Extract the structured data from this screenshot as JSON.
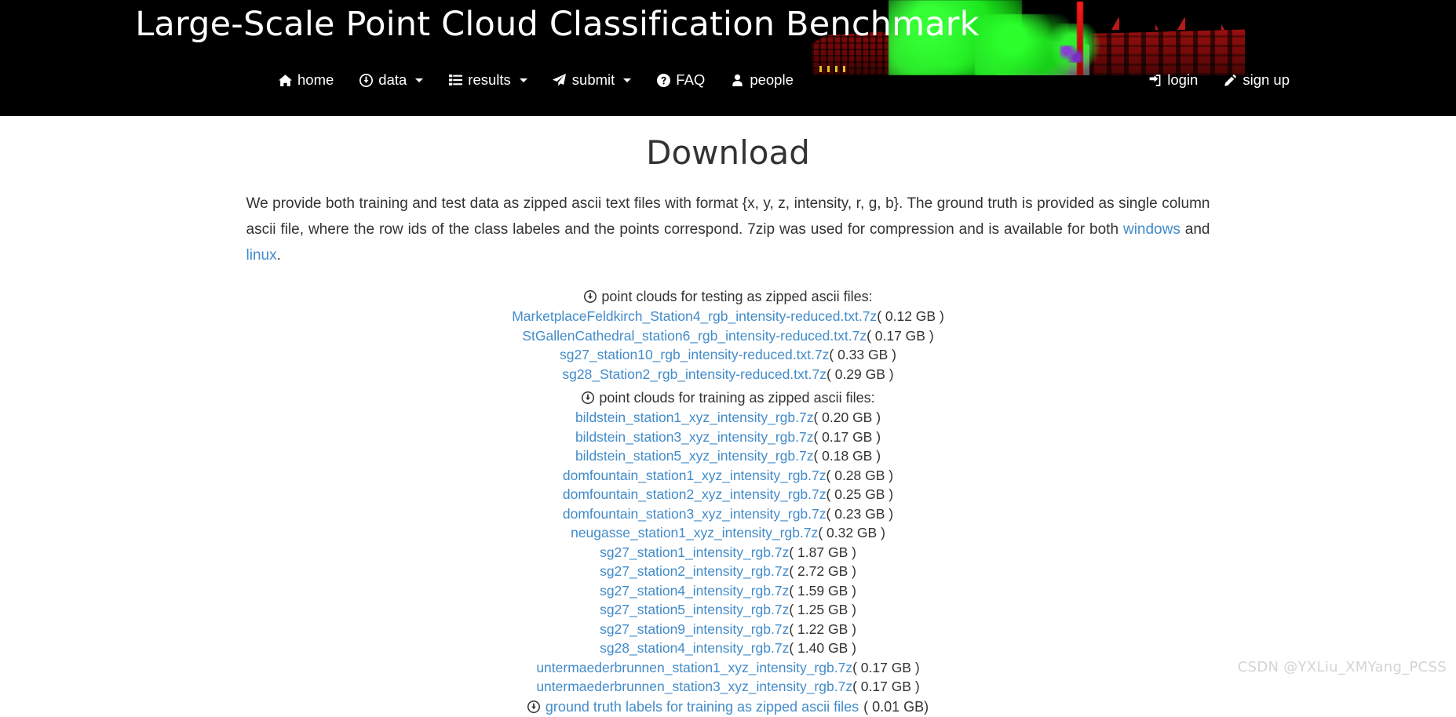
{
  "banner": {
    "title": "Large-Scale Point Cloud Classification Benchmark",
    "artwork_alt": "semantic point cloud of buildings and vegetation",
    "colors": {
      "background": "#000000",
      "buildings": "#8d0c0c",
      "vegetation": "#22f022",
      "ground": "#9a9a9a"
    }
  },
  "nav": {
    "left_items": [
      {
        "label": "home",
        "icon": "home-icon",
        "caret": false
      },
      {
        "label": "data",
        "icon": "download-circle-icon",
        "caret": true
      },
      {
        "label": "results",
        "icon": "list-icon",
        "caret": true
      },
      {
        "label": "submit",
        "icon": "paper-plane-icon",
        "caret": true
      },
      {
        "label": "FAQ",
        "icon": "question-circle-icon",
        "caret": false
      },
      {
        "label": "people",
        "icon": "user-icon",
        "caret": false
      }
    ],
    "right_items": [
      {
        "label": "login",
        "icon": "sign-in-icon",
        "caret": false
      },
      {
        "label": "sign up",
        "icon": "pencil-icon",
        "caret": false
      }
    ]
  },
  "page": {
    "title": "Download",
    "intro": {
      "part1": "We provide both training and test data as zipped ascii text files with format {x, y, z, intensity, r, g, b}. The ground truth is provided as single column ascii file, where the row ids of the class labeles and the points correspond. 7zip was used for compression and is available for both ",
      "link_windows": "windows",
      "between": " and ",
      "link_linux": "linux",
      "part_end": "."
    }
  },
  "testing": {
    "heading": "point clouds for testing as zipped ascii files:",
    "icon": "download-circle-icon",
    "files": [
      {
        "name": "MarketplaceFeldkirch_Station4_rgb_intensity-reduced.txt.7z",
        "size": "( 0.12 GB )"
      },
      {
        "name": "StGallenCathedral_station6_rgb_intensity-reduced.txt.7z",
        "size": "( 0.17 GB )"
      },
      {
        "name": "sg27_station10_rgb_intensity-reduced.txt.7z",
        "size": "( 0.33 GB )"
      },
      {
        "name": "sg28_Station2_rgb_intensity-reduced.txt.7z",
        "size": "( 0.29 GB )"
      }
    ]
  },
  "training": {
    "heading": "point clouds for training as zipped ascii files:",
    "icon": "download-circle-icon",
    "files": [
      {
        "name": "bildstein_station1_xyz_intensity_rgb.7z",
        "size": "( 0.20 GB )"
      },
      {
        "name": "bildstein_station3_xyz_intensity_rgb.7z",
        "size": "( 0.17 GB )"
      },
      {
        "name": "bildstein_station5_xyz_intensity_rgb.7z",
        "size": "( 0.18 GB )"
      },
      {
        "name": "domfountain_station1_xyz_intensity_rgb.7z",
        "size": "( 0.28 GB )"
      },
      {
        "name": "domfountain_station2_xyz_intensity_rgb.7z",
        "size": "( 0.25 GB )"
      },
      {
        "name": "domfountain_station3_xyz_intensity_rgb.7z",
        "size": "( 0.23 GB )"
      },
      {
        "name": "neugasse_station1_xyz_intensity_rgb.7z",
        "size": "( 0.32 GB )"
      },
      {
        "name": "sg27_station1_intensity_rgb.7z",
        "size": "( 1.87 GB )"
      },
      {
        "name": "sg27_station2_intensity_rgb.7z",
        "size": "( 2.72 GB )"
      },
      {
        "name": "sg27_station4_intensity_rgb.7z",
        "size": "( 1.59 GB )"
      },
      {
        "name": "sg27_station5_intensity_rgb.7z",
        "size": "( 1.25 GB )"
      },
      {
        "name": "sg27_station9_intensity_rgb.7z",
        "size": "( 1.22 GB )"
      },
      {
        "name": "sg28_station4_intensity_rgb.7z",
        "size": "( 1.40 GB )"
      },
      {
        "name": "untermaederbrunnen_station1_xyz_intensity_rgb.7z",
        "size": "( 0.17 GB )"
      },
      {
        "name": "untermaederbrunnen_station3_xyz_intensity_rgb.7z",
        "size": "( 0.17 GB )"
      }
    ]
  },
  "ground_truth": {
    "icon": "download-circle-icon",
    "label": "ground truth labels for training as zipped ascii files",
    "size": "( 0.01 GB)"
  },
  "watermark": "CSDN @YXLiu_XMYang_PCSS",
  "colors": {
    "link": "#428bca",
    "text": "#333333",
    "masthead": "#000000",
    "watermark": "#d4d4d4"
  }
}
